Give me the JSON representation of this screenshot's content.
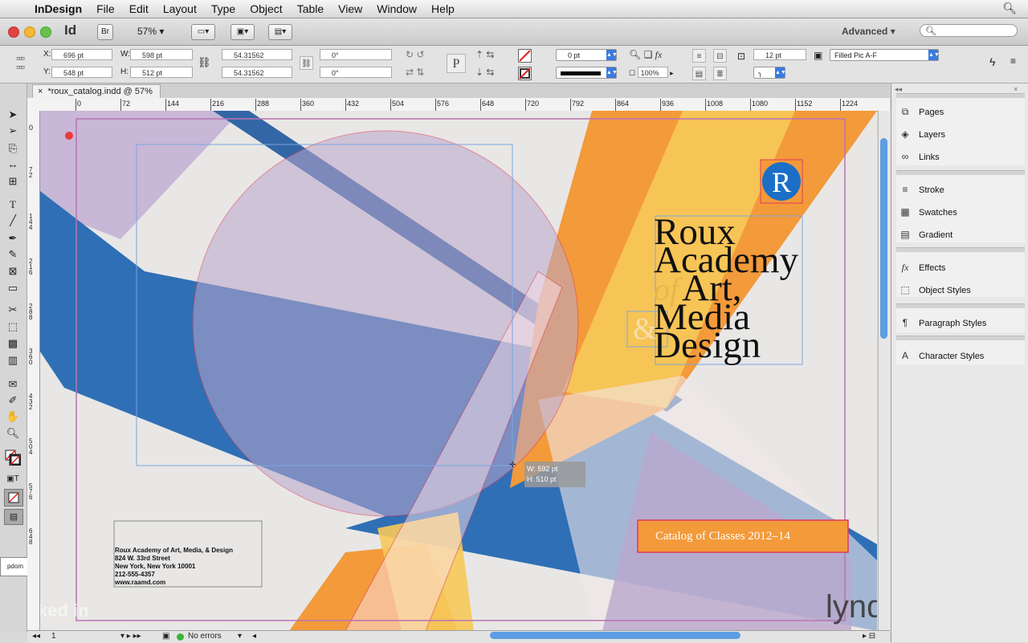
{
  "menubar": {
    "app_name": "InDesign",
    "items": [
      "File",
      "Edit",
      "Layout",
      "Type",
      "Object",
      "Table",
      "View",
      "Window",
      "Help"
    ]
  },
  "appbar": {
    "logo": "Id",
    "bridge": "Br",
    "zoom": "57%",
    "workspace": "Advanced"
  },
  "control": {
    "x_label": "X:",
    "x_value": "696 pt",
    "y_label": "Y:",
    "y_value": "548 pt",
    "w_label": "W:",
    "w_value": "598 pt",
    "h_label": "H:",
    "h_value": "512 pt",
    "scale_x": "54.31562",
    "scale_y": "54.31562",
    "rotate": "0°",
    "shear": "0°",
    "stroke_weight": "0 pt",
    "opacity": "100%",
    "spacing": "12 pt",
    "object_style": "Filled Pic A-F"
  },
  "document": {
    "tab_label": "*roux_catalog.indd @ 57%",
    "ruler_h": [
      "0",
      "72",
      "144",
      "216",
      "288",
      "360",
      "432",
      "504",
      "576",
      "648",
      "720",
      "792",
      "864",
      "936",
      "1008",
      "1080",
      "1152",
      "1224"
    ],
    "ruler_v": [
      "0",
      "7 2",
      "1 4 4",
      "2 1 6",
      "2 8 8",
      "3 6 0",
      "4 3 2",
      "5 0 4",
      "5 7 6",
      "6 4 8"
    ]
  },
  "layout": {
    "title_lines": [
      "Roux",
      "Academy",
      "Art,",
      "Media",
      "Design"
    ],
    "title_of": "of",
    "ampersand": "&",
    "logo_letter": "R",
    "catalog_banner": "Catalog of Classes 2012–14",
    "address": [
      "Roux Academy of Art, Media, & Design",
      "824 W. 33rd Street",
      "New York, New York 10001",
      "212-555-4357",
      "www.raamd.com"
    ],
    "side_label": "pdom",
    "tooltip_w": "W: 592 pt",
    "tooltip_h": "H: 510 pt"
  },
  "status": {
    "page": "1",
    "errors": "No errors"
  },
  "panels": [
    {
      "label": "Pages",
      "icon": "pages-icon"
    },
    {
      "label": "Layers",
      "icon": "layers-icon"
    },
    {
      "label": "Links",
      "icon": "links-icon"
    },
    {
      "label": "Stroke",
      "icon": "stroke-icon"
    },
    {
      "label": "Swatches",
      "icon": "swatches-icon"
    },
    {
      "label": "Gradient",
      "icon": "gradient-icon"
    },
    {
      "label": "Effects",
      "icon": "effects-icon"
    },
    {
      "label": "Object Styles",
      "icon": "object-styles-icon"
    },
    {
      "label": "Paragraph Styles",
      "icon": "paragraph-styles-icon"
    },
    {
      "label": "Character Styles",
      "icon": "character-styles-icon"
    }
  ],
  "watermark": {
    "linkedin": "Linked in",
    "lynda": "lynda.com"
  },
  "colors": {
    "blue": "#2f6fb5",
    "orange": "#f39a3a",
    "yellow": "#f7c95a",
    "lilac": "#b9a7cc",
    "selection": "#e03a5a",
    "accent": "#3a7be0"
  }
}
